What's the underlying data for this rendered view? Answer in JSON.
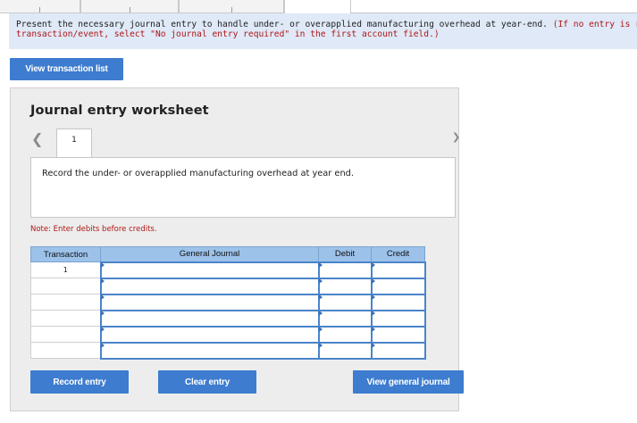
{
  "tabs": {
    "count": 4
  },
  "banner": {
    "line1": "Present the necessary journal entry to handle under- or overapplied manufacturing overhead at year-end. ",
    "line1_red": "(If no entry is required fo",
    "line2_red": "transaction/event, select \"No journal entry required\" in the first account field.)"
  },
  "view_transaction_list": "View transaction list",
  "worksheet": {
    "title": "Journal entry worksheet",
    "prev_icon": "chevron-left-icon",
    "next_icon": "chevron-right-icon",
    "page_tab": "1",
    "description": "Record the under- or overapplied manufacturing overhead at year end.",
    "note": "Note: Enter debits before credits.",
    "columns": {
      "transaction": "Transaction",
      "general_journal": "General Journal",
      "debit": "Debit",
      "credit": "Credit"
    },
    "rows": [
      {
        "transaction": "1",
        "account": "",
        "debit": "",
        "credit": ""
      },
      {
        "transaction": "",
        "account": "",
        "debit": "",
        "credit": ""
      },
      {
        "transaction": "",
        "account": "",
        "debit": "",
        "credit": ""
      },
      {
        "transaction": "",
        "account": "",
        "debit": "",
        "credit": ""
      },
      {
        "transaction": "",
        "account": "",
        "debit": "",
        "credit": ""
      },
      {
        "transaction": "",
        "account": "",
        "debit": "",
        "credit": ""
      }
    ],
    "buttons": {
      "record": "Record entry",
      "clear": "Clear entry",
      "view_general": "View general journal"
    }
  },
  "colors": {
    "button": "#3d7ccf",
    "header": "#9cc2ea",
    "banner": "#dfe9f7",
    "note_red": "#b01616"
  }
}
